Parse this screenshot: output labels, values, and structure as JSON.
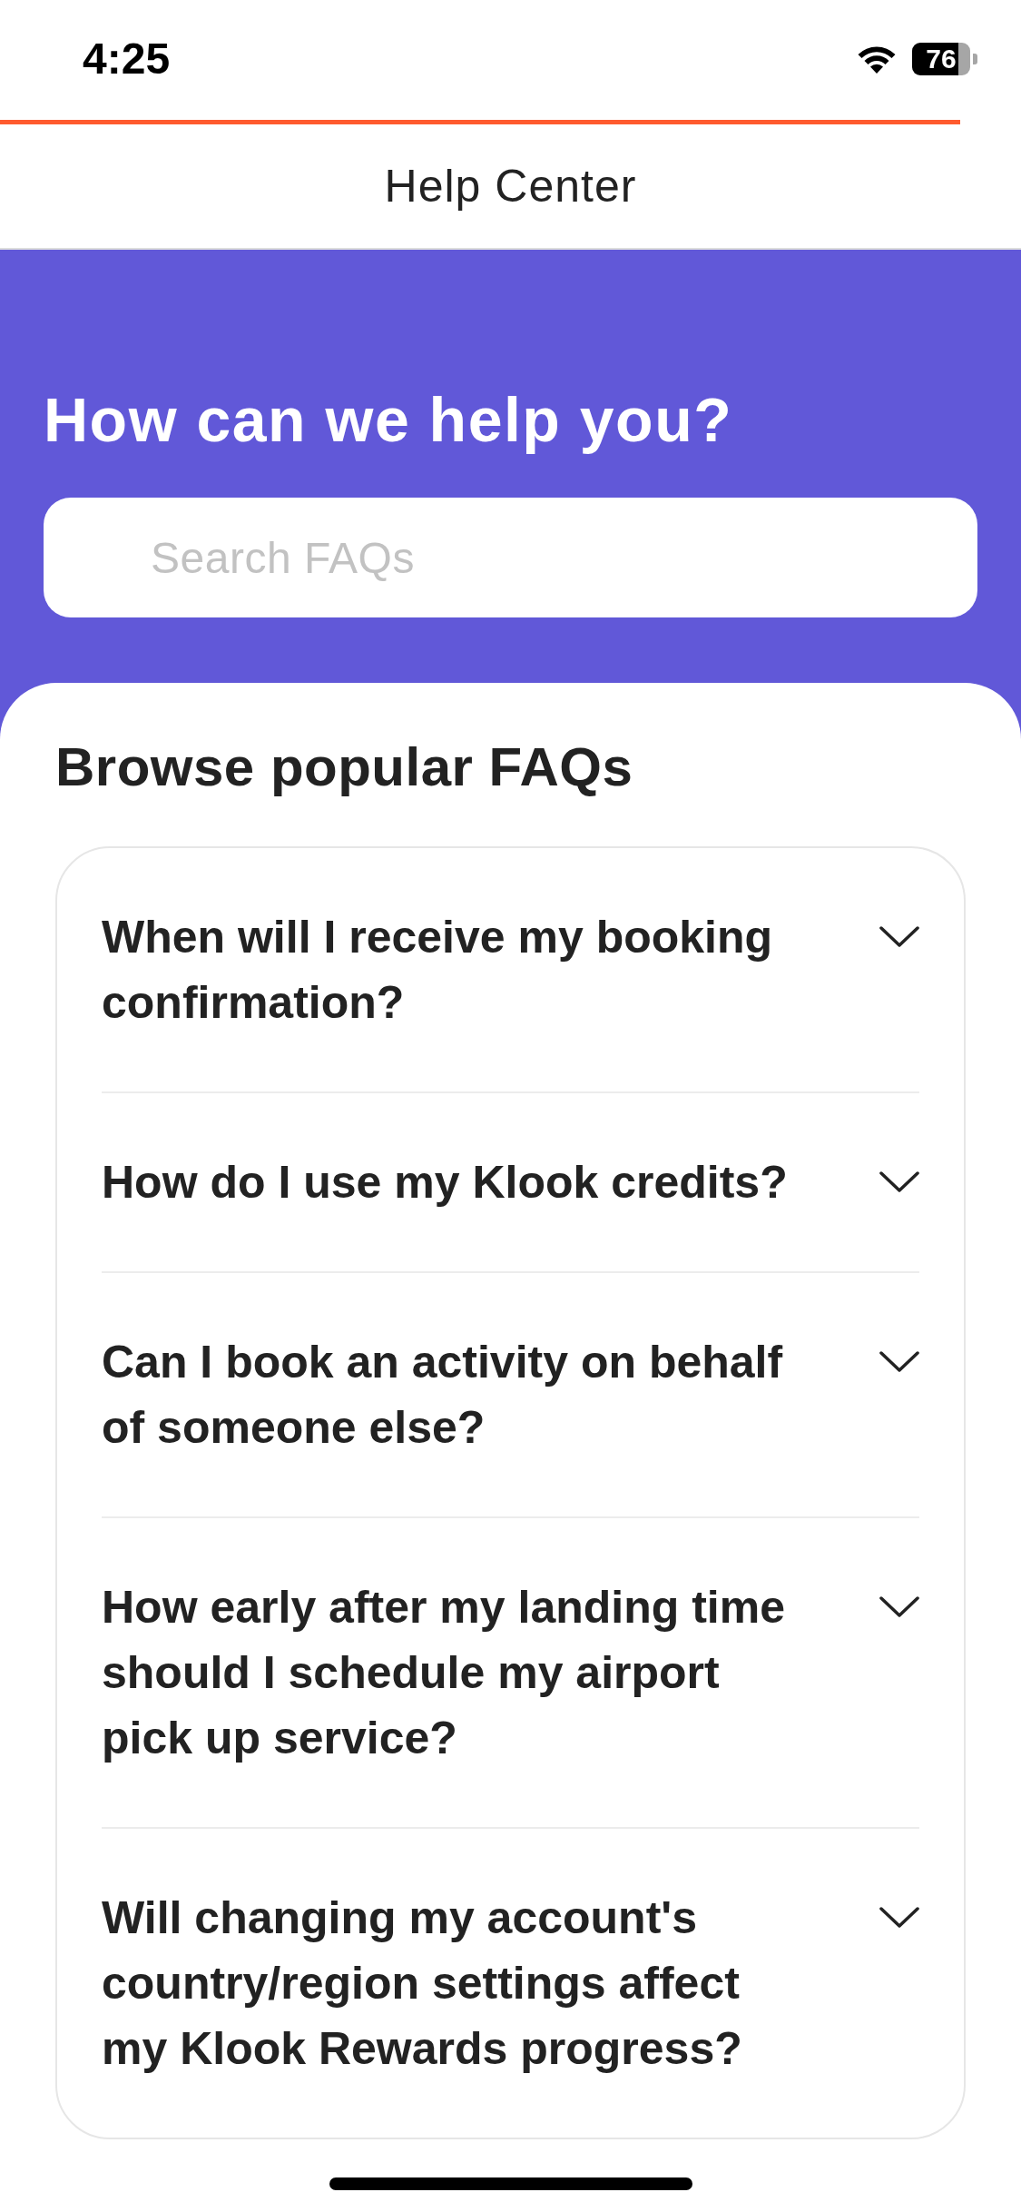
{
  "status_bar": {
    "time": "4:25",
    "battery": "76"
  },
  "progress_bar": {
    "level": 0.94
  },
  "header": {
    "title": "Help Center"
  },
  "hero": {
    "title": "How can we help you?",
    "search": {
      "placeholder": "Search FAQs"
    }
  },
  "faq_section": {
    "title": "Browse popular FAQs",
    "items": [
      {
        "question": "When will I receive my booking confirmation?",
        "expanded": false
      },
      {
        "question": "How do I use my Klook credits?",
        "expanded": false
      },
      {
        "question": "Can I book an activity on behalf of someone else?",
        "expanded": false
      },
      {
        "question": "How early after my landing time should I schedule my airport pick up service?",
        "expanded": false
      },
      {
        "question": "Will changing my account's country/region settings affect my Klook Rewards progress?",
        "expanded": false
      }
    ]
  }
}
